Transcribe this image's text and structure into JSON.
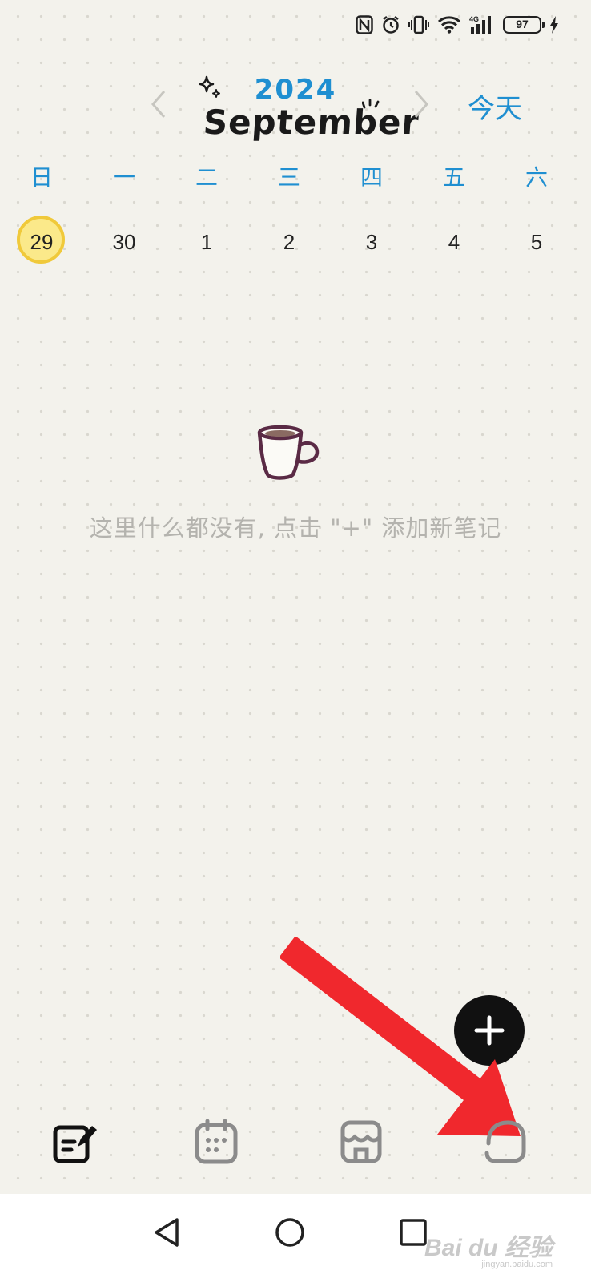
{
  "status_bar": {
    "battery_level": "97",
    "icons": [
      "nfc-icon",
      "alarm-icon",
      "vibrate-icon",
      "wifi-icon",
      "signal-4g-icon",
      "battery-icon",
      "charging-icon"
    ]
  },
  "header": {
    "year": "2024",
    "month": "September",
    "today_label": "今天"
  },
  "weekdays": [
    "日",
    "一",
    "二",
    "三",
    "四",
    "五",
    "六"
  ],
  "dates": [
    {
      "day": "29",
      "selected": true
    },
    {
      "day": "30",
      "selected": false
    },
    {
      "day": "1",
      "selected": false
    },
    {
      "day": "2",
      "selected": false
    },
    {
      "day": "3",
      "selected": false
    },
    {
      "day": "4",
      "selected": false
    },
    {
      "day": "5",
      "selected": false
    }
  ],
  "empty_state": {
    "icon": "coffee-cup-icon",
    "message": "这里什么都没有, 点击 \"+\" 添加新笔记"
  },
  "fab": {
    "icon": "plus-icon"
  },
  "tabbar": {
    "tabs": [
      {
        "icon": "note-edit-icon",
        "active": true
      },
      {
        "icon": "calendar-icon",
        "active": false
      },
      {
        "icon": "store-icon",
        "active": false
      },
      {
        "icon": "profile-face-icon",
        "active": false
      }
    ]
  },
  "colors": {
    "accent": "#1f8fd1",
    "selected_fill": "#fbe98a",
    "selected_ring": "#f0c93a",
    "background": "#f3f2ec",
    "annotation_arrow": "#f0282d"
  },
  "watermark": {
    "brand": "Bai du 经验",
    "domain": "jingyan.baidu.com"
  }
}
